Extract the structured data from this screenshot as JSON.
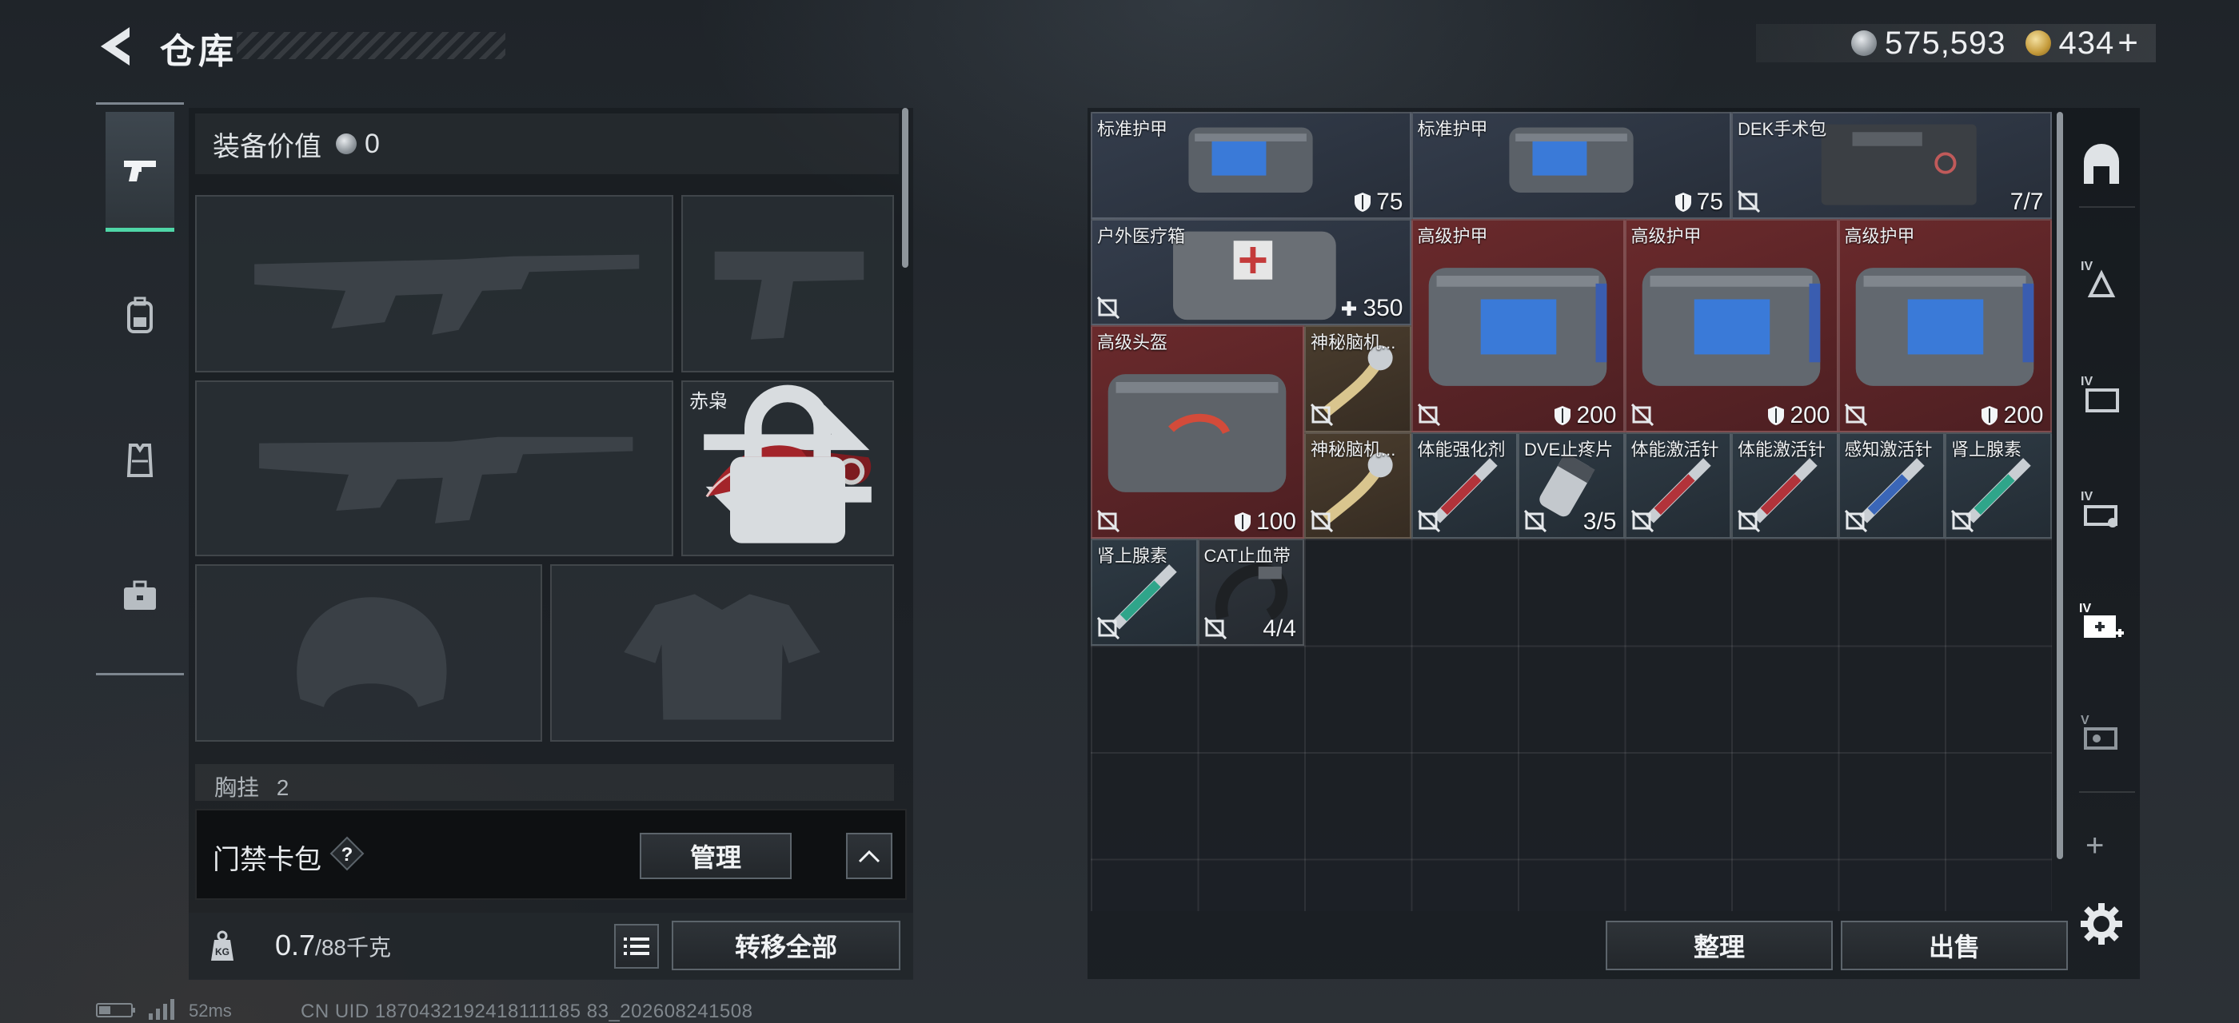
{
  "header": {
    "title": "仓库",
    "silver_amount": "575,593",
    "gold_amount": "434",
    "gold_plus": "+"
  },
  "tabs": [
    {
      "icon": "pistol-icon",
      "active": true
    },
    {
      "icon": "backpack-icon",
      "active": false
    },
    {
      "icon": "vest-icon",
      "active": false
    },
    {
      "icon": "briefcase-icon",
      "active": false
    }
  ],
  "loadout": {
    "equip_value_label": "装备价值",
    "equip_value": "0",
    "melee_label": "赤枭",
    "chest_label": "胸挂",
    "chest_count": "2"
  },
  "keycard": {
    "label": "门禁卡包",
    "help": "?",
    "manage_label": "管理"
  },
  "weight": {
    "current": "0.7",
    "max": "/88千克",
    "transfer_all_label": "转移全部"
  },
  "footer": {
    "ping": "52ms",
    "uid": "CN UID 1870432192418111185 83_202608241508"
  },
  "stash": {
    "items": [
      {
        "name": "标准护甲",
        "stat": "75",
        "stat_icon": "shield",
        "color": "blue",
        "art": "bag-small"
      },
      {
        "name": "标准护甲",
        "stat": "75",
        "stat_icon": "shield",
        "color": "blue",
        "art": "bag-small"
      },
      {
        "name": "DEK手术包",
        "stat": "7/7",
        "stat_icon": "none",
        "color": "blue",
        "art": "surgery-kit",
        "uninsured": true
      },
      {
        "name": "户外医疗箱",
        "stat": "350",
        "stat_icon": "plus",
        "color": "blue",
        "art": "med-box",
        "uninsured": true
      },
      {
        "name": "高级护甲",
        "stat": "200",
        "stat_icon": "shield",
        "color": "red",
        "art": "bag-big",
        "uninsured": true
      },
      {
        "name": "高级护甲",
        "stat": "200",
        "stat_icon": "shield",
        "color": "red",
        "art": "bag-big",
        "uninsured": true
      },
      {
        "name": "高级护甲",
        "stat": "200",
        "stat_icon": "shield",
        "color": "red",
        "art": "bag-big",
        "uninsured": true
      },
      {
        "name": "高级头盔",
        "stat": "100",
        "stat_icon": "shield",
        "color": "red",
        "art": "bag-helmet",
        "uninsured": true
      },
      {
        "name": "神秘脑机...",
        "stat": "",
        "stat_icon": "none",
        "color": "brown",
        "art": "brain-chip",
        "uninsured": true
      },
      {
        "name": "神秘脑机...",
        "stat": "",
        "stat_icon": "none",
        "color": "brown",
        "art": "brain-chip",
        "uninsured": true
      },
      {
        "name": "体能强化剂",
        "stat": "",
        "stat_icon": "none",
        "color": "teal",
        "art": "syringe-red",
        "uninsured": true
      },
      {
        "name": "DVE止疼片",
        "stat": "3/5",
        "stat_icon": "none",
        "color": "teal",
        "art": "pill",
        "uninsured": true
      },
      {
        "name": "体能激活针",
        "stat": "",
        "stat_icon": "none",
        "color": "teal",
        "art": "syringe-red",
        "uninsured": true
      },
      {
        "name": "体能激活针",
        "stat": "",
        "stat_icon": "none",
        "color": "teal",
        "art": "syringe-red",
        "uninsured": true
      },
      {
        "name": "感知激活针",
        "stat": "",
        "stat_icon": "none",
        "color": "teal",
        "art": "syringe-blue",
        "uninsured": true
      },
      {
        "name": "肾上腺素",
        "stat": "",
        "stat_icon": "none",
        "color": "teal",
        "art": "syringe-green",
        "uninsured": true
      },
      {
        "name": "肾上腺素",
        "stat": "",
        "stat_icon": "none",
        "color": "teal",
        "art": "syringe-green",
        "uninsured": true
      },
      {
        "name": "CAT止血带",
        "stat": "4/4",
        "stat_icon": "none",
        "color": "grey",
        "art": "tourniquet",
        "uninsured": true
      }
    ],
    "sort_label": "整理",
    "sell_label": "出售"
  },
  "right_rail": {
    "icons": [
      "safe-room-icon",
      "tier4-armor-icon",
      "tier4-folder-icon",
      "tier4-card-icon",
      "tier4-medkit-icon",
      "tier5-card-icon"
    ],
    "add": "+"
  }
}
